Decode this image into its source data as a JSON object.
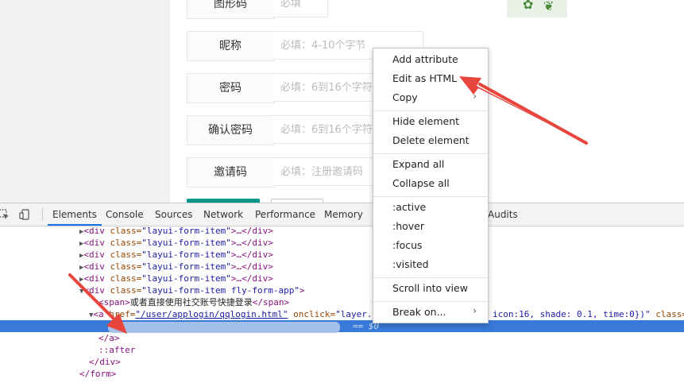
{
  "form": {
    "rows": [
      {
        "label": "图形码",
        "placeholder": "必填"
      },
      {
        "label": "昵称",
        "placeholder": "必填：4-10个字节"
      },
      {
        "label": "密码",
        "placeholder": "必填：6到16个字符"
      },
      {
        "label": "确认密码",
        "placeholder": "必填：6到16个字符"
      },
      {
        "label": "邀请码",
        "placeholder": "必填：注册邀请码"
      }
    ]
  },
  "devtools": {
    "tabs": [
      "Elements",
      "Console",
      "Sources",
      "Network",
      "Performance",
      "Memory",
      "Audits"
    ],
    "active_tab": "Elements",
    "code": {
      "div_open": "<div",
      "class_attr": "class=",
      "form_item_class": "\"layui-form-item\"",
      "ellipsis_close": ">…</div>",
      "fly_class": "\"layui-form-item fly-form-app\"",
      "gt": ">",
      "span_open": "<span>",
      "span_text": "或者直接使用社交账号快捷登录",
      "span_close": "</span>",
      "href_attr": "href=",
      "href_val": "\"/user/applogin/qqlogin.html\"",
      "onclick_attr": "onclick=",
      "onclick_val_start": "\"layer.",
      "onclick_val_end": "icon:16, shade: 0.1, time:0})\"",
      "class_tail": "class=",
      "eq_dollar": "== $0",
      "a_close": "</a>",
      "after": "::after",
      "div_close": "</div>",
      "form_close": "</form>"
    }
  },
  "context_menu": {
    "items": [
      "Add attribute",
      "Edit as HTML",
      "Copy",
      "Hide element",
      "Delete element",
      "Expand all",
      "Collapse all",
      ":active",
      ":hover",
      ":focus",
      ":visited",
      "Scroll into view",
      "Break on..."
    ]
  },
  "colors": {
    "accent": "#009688",
    "selection": "#3879d9",
    "arrow": "#e8453c"
  }
}
